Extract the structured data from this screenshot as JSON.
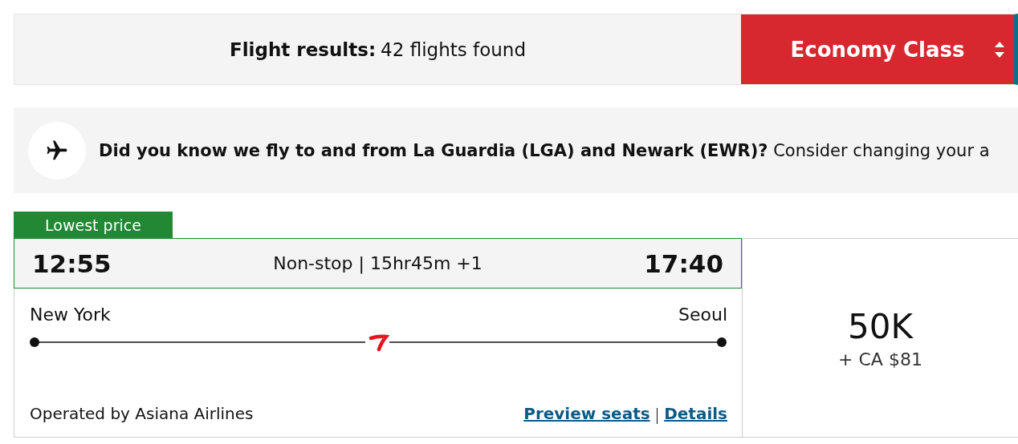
{
  "results_bar": {
    "label": "Flight results:",
    "count": "42 flights found",
    "cabin_select": {
      "value": "Economy Class"
    }
  },
  "banner": {
    "text": "**Did you know we fly to and from La Guardia (LGA) and Newark (EWR)?** Consider changing your a"
  },
  "flight": {
    "tag": "Lowest price",
    "depart_time": "12:55",
    "summary": "Non-stop | 15hr45m +1",
    "arrive_time": "17:40",
    "origin": "New York",
    "destination": "Seoul",
    "operator": "Operated by Asiana Airlines",
    "links": [
      {
        "label": "Preview seats"
      },
      {
        "label": "Details"
      }
    ],
    "price": {
      "points": "50K",
      "cash": "+ CA $81"
    }
  }
}
